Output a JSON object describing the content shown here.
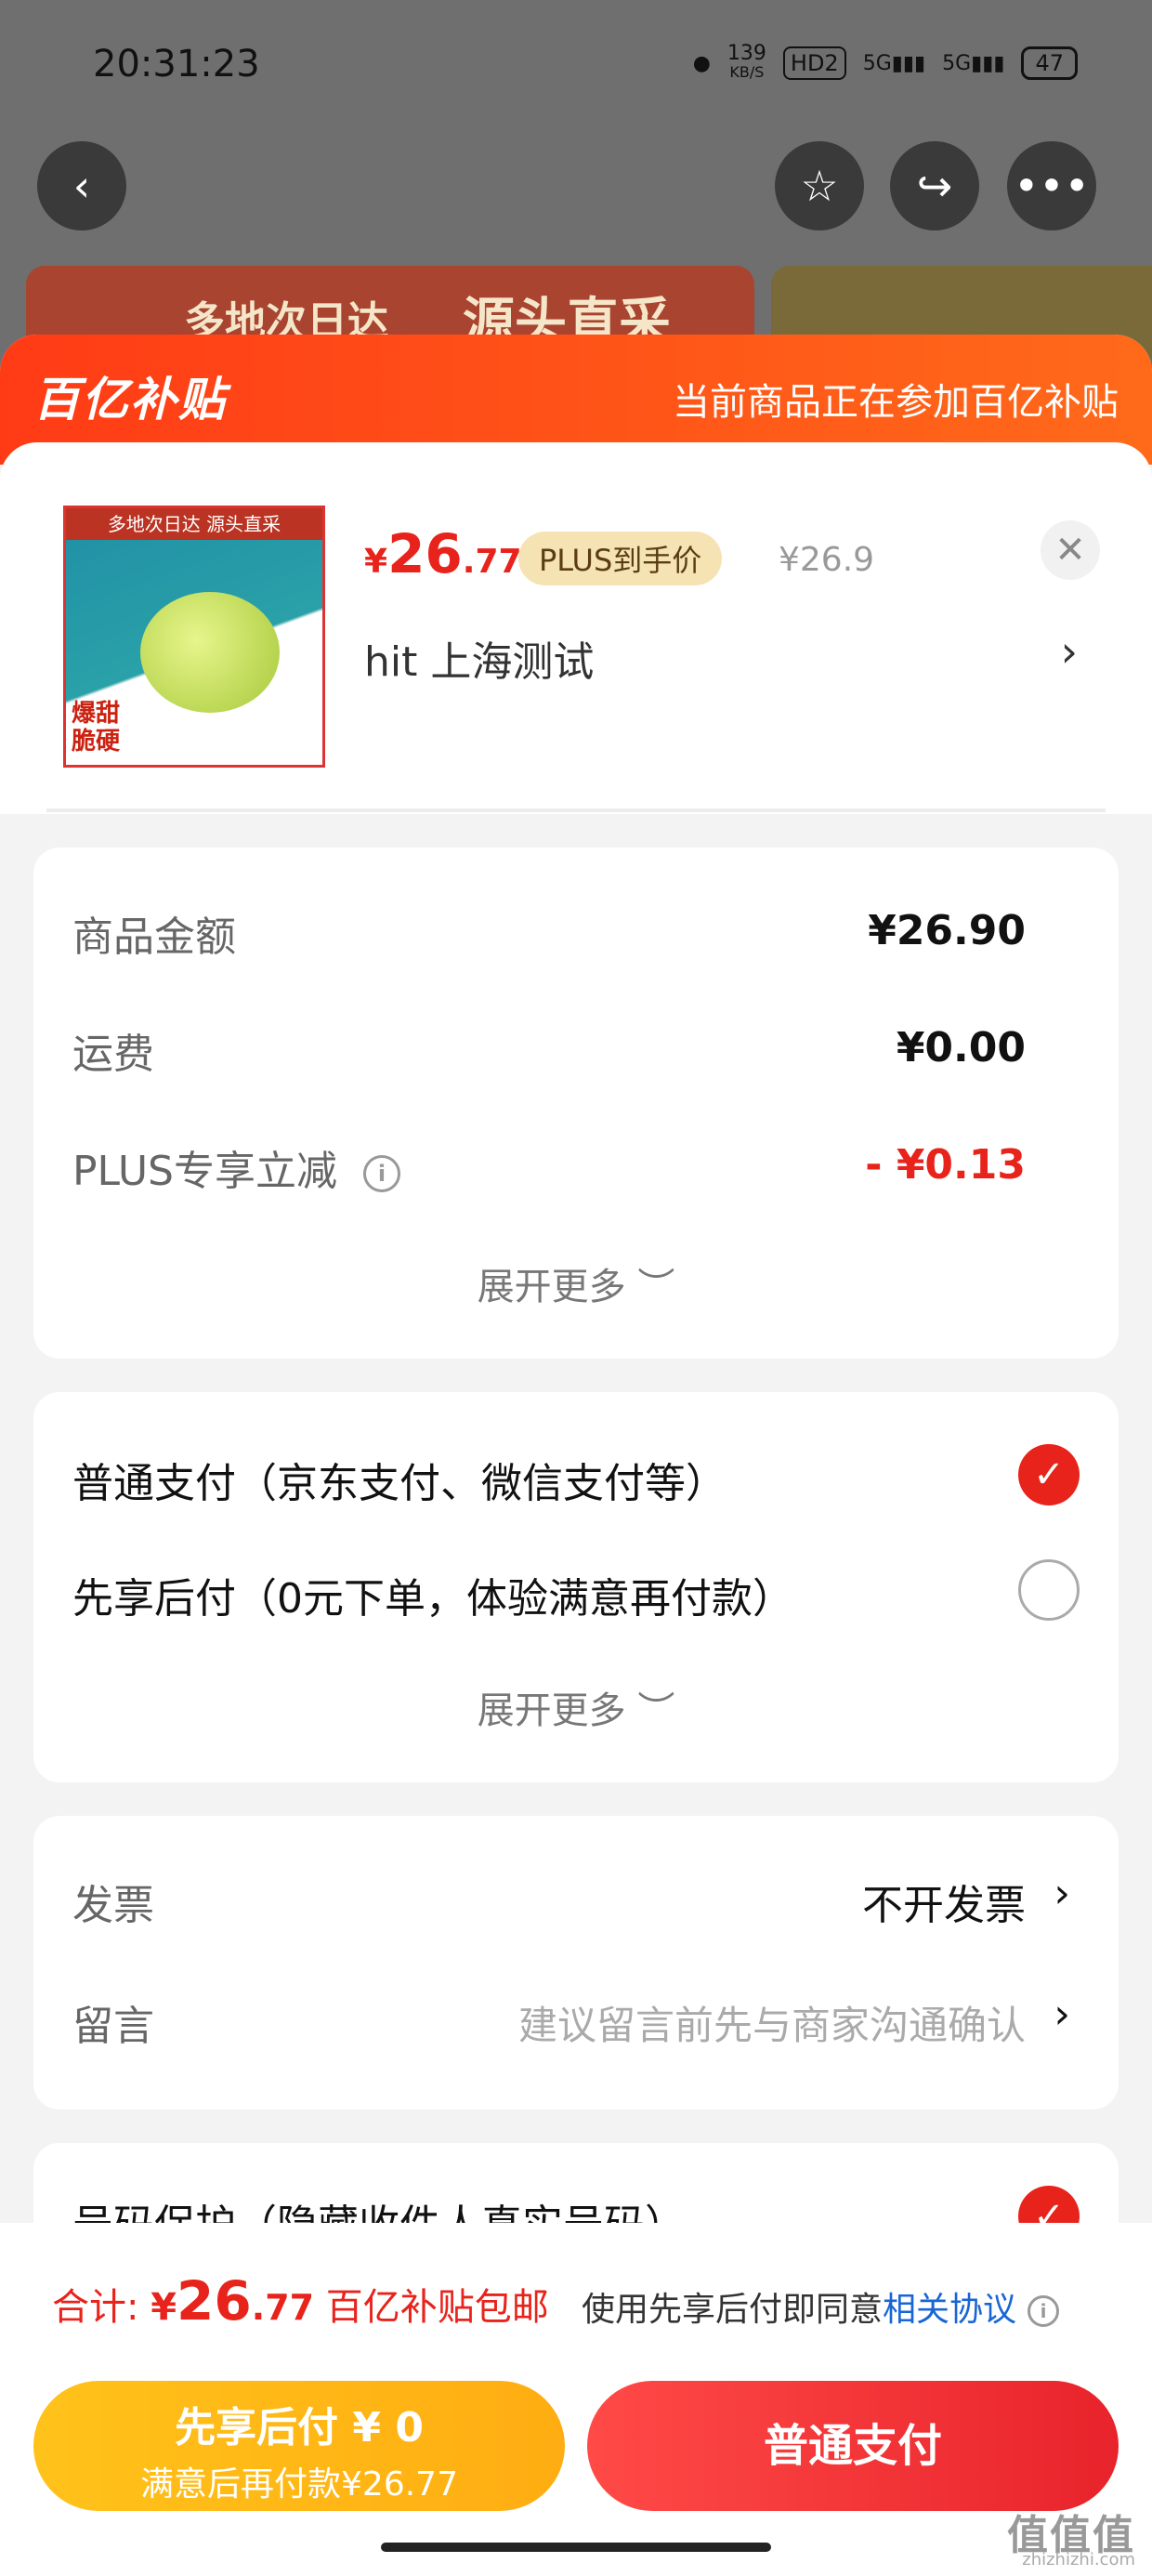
{
  "status_bar": {
    "time": "20:31:23",
    "speed_top": "139",
    "speed_unit": "KB/S",
    "hd": "HD2",
    "net1": "5G",
    "net2": "5G",
    "battery": "47"
  },
  "top_bar": {
    "back_icon": "back-arrow-icon",
    "favorite_icon": "star-icon",
    "share_icon": "share-icon",
    "more_icon": "more-dots-icon"
  },
  "background_banner": {
    "text1": "多地次日达",
    "text2": "源头直采"
  },
  "sheet": {
    "brand": "百亿补贴",
    "brand_note": "当前商品正在参加百亿补贴",
    "product": {
      "price_yen": "¥",
      "price_int": "26",
      "price_dec": ".77",
      "plus_tag": "PLUS到手价",
      "original_price": "¥26.9",
      "address": "hit  上海测试",
      "thumb_top": "多地次日达 源头直采",
      "thumb_bottom1": "爆甜",
      "thumb_bottom2": "脆硬"
    },
    "summary": {
      "goods_label": "商品金额",
      "goods_value": "¥26.90",
      "shipping_label": "运费",
      "shipping_value": "¥0.00",
      "plus_label": "PLUS专享立减",
      "plus_value": "- ¥0.13",
      "expand": "展开更多 ︶"
    },
    "payment": {
      "option1": "普通支付（京东支付、微信支付等）",
      "option2": "先享后付（0元下单，体验满意再付款）",
      "expand": "展开更多 ︶"
    },
    "extras": {
      "invoice_label": "发票",
      "invoice_value": "不开发票",
      "note_label": "留言",
      "note_placeholder": "建议留言前先与商家沟通确认"
    },
    "privacy": {
      "label": "号码保护（隐藏收件人真实号码）"
    }
  },
  "bottom_bar": {
    "total_label": "合计: ",
    "total_yen": "¥",
    "total_int": "26",
    "total_dec": ".77",
    "total_note": " 百亿补贴包邮",
    "agree_prefix": "使用先享后付即同意",
    "agree_link": "相关协议",
    "left_button_line1": "先享后付 ¥ 0",
    "left_button_line2": "满意后再付款¥26.77",
    "right_button": "普通支付",
    "watermark": "值值值",
    "watermark_sub": "zhizhizhi.com"
  },
  "colors": {
    "accent_red": "#e8231b",
    "brand_orange": "#ff4a16",
    "gold": "#ffb515"
  }
}
